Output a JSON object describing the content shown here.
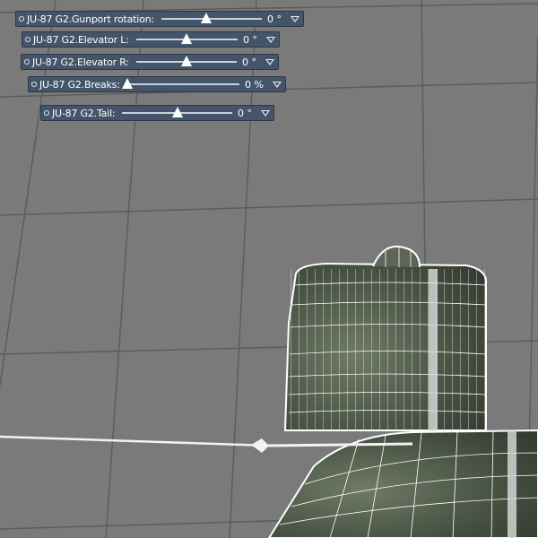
{
  "sliders": [
    {
      "label": "JU-87 G2.Gunport rotation:",
      "value": "0 °",
      "position": 0.45
    },
    {
      "label": "JU-87 G2.Elevator L:",
      "value": "0 °",
      "position": 0.5
    },
    {
      "label": "JU-87 G2.Elevator R:",
      "value": "0 °",
      "position": 0.5
    },
    {
      "label": "JU-87 G2.Breaks:",
      "value": "0 %",
      "position": 0.0
    },
    {
      "label": "JU-87 G2.Tail:",
      "value": "0 °",
      "position": 0.5
    }
  ],
  "colors": {
    "viewport_bg": "#7a7a7a",
    "panel_bg": "#44556a",
    "grid_line": "#5f5f5f",
    "mesh_fill": "#4e5a48",
    "wireframe": "#ffffff"
  },
  "icons": {
    "knob": "knob-icon",
    "dropdown": "dropdown-icon"
  }
}
